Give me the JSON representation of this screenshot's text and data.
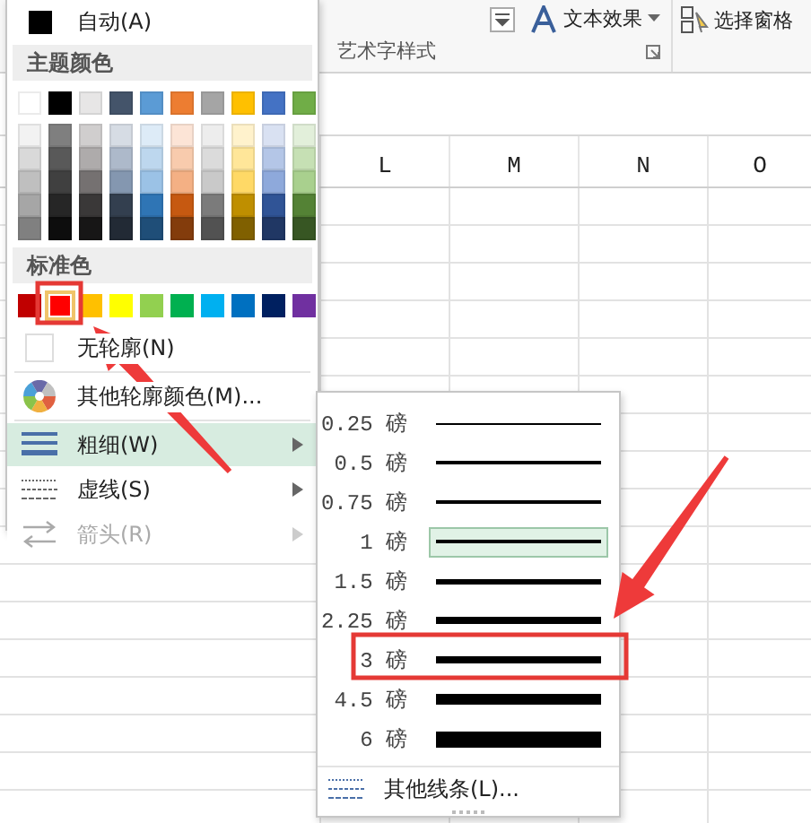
{
  "ribbon": {
    "text_effect": "文本效果",
    "select_pane": "选择窗格",
    "group_label": "艺术字样式"
  },
  "columns": [
    "L",
    "M",
    "N",
    "O"
  ],
  "outline_menu": {
    "automatic": {
      "label": "自动(A)",
      "color": "#000000"
    },
    "theme_header": "主题颜色",
    "theme_colors": [
      {
        "color": "#ffffff",
        "shades": [
          {
            "color": "#f2f2f2"
          },
          {
            "color": "#d9d9d9"
          },
          {
            "color": "#bfbfbf"
          },
          {
            "color": "#a6a6a6"
          },
          {
            "color": "#808080"
          }
        ]
      },
      {
        "color": "#000000",
        "shades": [
          {
            "color": "#7f7f7f"
          },
          {
            "color": "#595959"
          },
          {
            "color": "#404040"
          },
          {
            "color": "#262626"
          },
          {
            "color": "#0d0d0d"
          }
        ]
      },
      {
        "color": "#e7e6e6",
        "shades": [
          {
            "color": "#d0cece"
          },
          {
            "color": "#aeabab"
          },
          {
            "color": "#757171"
          },
          {
            "color": "#3a3838"
          },
          {
            "color": "#171616"
          }
        ]
      },
      {
        "color": "#44546a",
        "shades": [
          {
            "color": "#d6dce4"
          },
          {
            "color": "#adb9ca"
          },
          {
            "color": "#8497b0"
          },
          {
            "color": "#333f4f"
          },
          {
            "color": "#222a35"
          }
        ]
      },
      {
        "color": "#5b9bd5",
        "shades": [
          {
            "color": "#ddebf7"
          },
          {
            "color": "#bdd7ee"
          },
          {
            "color": "#9bc2e6"
          },
          {
            "color": "#2f75b5"
          },
          {
            "color": "#1f4e78"
          }
        ]
      },
      {
        "color": "#ed7d31",
        "shades": [
          {
            "color": "#fce4d6"
          },
          {
            "color": "#f8cbad"
          },
          {
            "color": "#f4b084"
          },
          {
            "color": "#c65911"
          },
          {
            "color": "#833c0c"
          }
        ]
      },
      {
        "color": "#a5a5a5",
        "shades": [
          {
            "color": "#ededed"
          },
          {
            "color": "#dbdbdb"
          },
          {
            "color": "#c9c9c9"
          },
          {
            "color": "#7b7b7b"
          },
          {
            "color": "#525252"
          }
        ]
      },
      {
        "color": "#ffc000",
        "shades": [
          {
            "color": "#fff2cc"
          },
          {
            "color": "#ffe699"
          },
          {
            "color": "#ffd966"
          },
          {
            "color": "#bf8f00"
          },
          {
            "color": "#806000"
          }
        ]
      },
      {
        "color": "#4472c4",
        "shades": [
          {
            "color": "#d9e1f2"
          },
          {
            "color": "#b4c6e7"
          },
          {
            "color": "#8ea9db"
          },
          {
            "color": "#305496"
          },
          {
            "color": "#203764"
          }
        ]
      },
      {
        "color": "#70ad47",
        "shades": [
          {
            "color": "#e2efda"
          },
          {
            "color": "#c6e0b4"
          },
          {
            "color": "#a9d08e"
          },
          {
            "color": "#548235"
          },
          {
            "color": "#375623"
          }
        ]
      }
    ],
    "standard_header": "标准色",
    "standard_colors": [
      {
        "color": "#c00000",
        "selected": false
      },
      {
        "color": "#ff0000",
        "selected": true
      },
      {
        "color": "#ffc000",
        "selected": false
      },
      {
        "color": "#ffff00",
        "selected": false
      },
      {
        "color": "#92d050",
        "selected": false
      },
      {
        "color": "#00b050",
        "selected": false
      },
      {
        "color": "#00b0f0",
        "selected": false
      },
      {
        "color": "#0070c0",
        "selected": false
      },
      {
        "color": "#002060",
        "selected": false
      },
      {
        "color": "#7030a0",
        "selected": false
      }
    ],
    "items": [
      {
        "kind": "no-outline",
        "label": "无轮廓(N)",
        "selected": false,
        "disabled": false,
        "has_submenu": false
      },
      {
        "kind": "more-colors",
        "label": "其他轮廓颜色(M)...",
        "selected": false,
        "disabled": false,
        "has_submenu": false
      },
      {
        "kind": "weight",
        "label": "粗细(W)",
        "selected": true,
        "disabled": false,
        "has_submenu": true
      },
      {
        "kind": "dash",
        "label": "虚线(S)",
        "selected": false,
        "disabled": false,
        "has_submenu": true
      },
      {
        "kind": "arrow",
        "label": "箭头(R)",
        "selected": false,
        "disabled": true,
        "has_submenu": true
      }
    ]
  },
  "weight_menu": {
    "weights": [
      {
        "label": "0.25 磅",
        "selected": false
      },
      {
        "label": "0.5 磅",
        "selected": false
      },
      {
        "label": "0.75 磅",
        "selected": false
      },
      {
        "label": "1 磅",
        "selected": true
      },
      {
        "label": "1.5 磅",
        "selected": false
      },
      {
        "label": "2.25 磅",
        "selected": false
      },
      {
        "label": "3 磅",
        "selected": false
      },
      {
        "label": "4.5 磅",
        "selected": false
      },
      {
        "label": "6 磅",
        "selected": false
      }
    ],
    "more": "其他线条(L)..."
  }
}
